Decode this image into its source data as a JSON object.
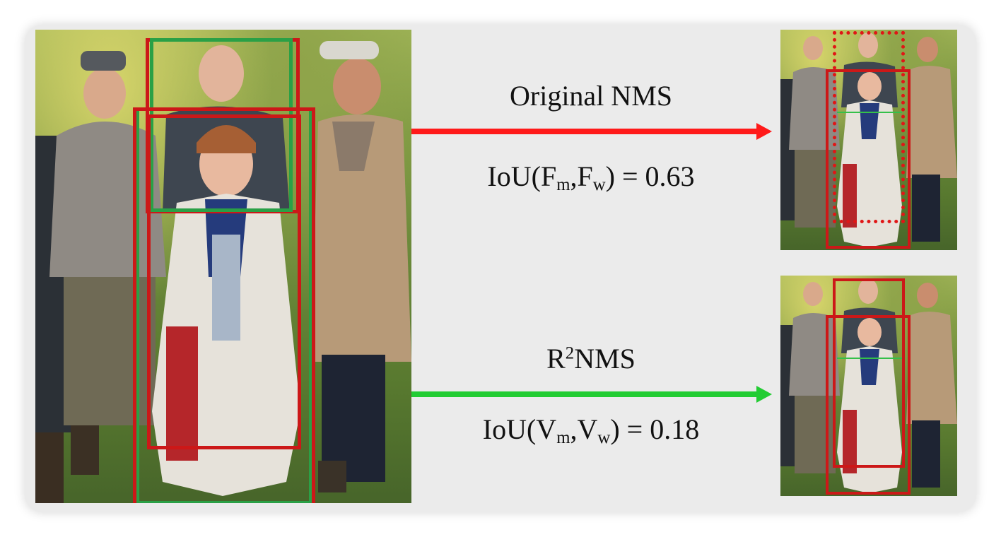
{
  "top": {
    "method": "Original NMS",
    "iou_prefix": "IoU(F",
    "iou_sub1": "m",
    "iou_mid": ",F",
    "iou_sub2": "w",
    "iou_suffix": ") = 0.63",
    "arrow_color": "#ff1a1a"
  },
  "bottom": {
    "method_prefix": "R",
    "method_sup": "2",
    "method_suffix": "NMS",
    "iou_prefix": "IoU(V",
    "iou_sub1": "m",
    "iou_mid": ",V",
    "iou_sub2": "w",
    "iou_suffix": ") = 0.18",
    "arrow_color": "#22cc33"
  },
  "colors": {
    "box_red": "#cc1818",
    "box_green": "#2aa046",
    "card_background": "#ebebeb"
  }
}
